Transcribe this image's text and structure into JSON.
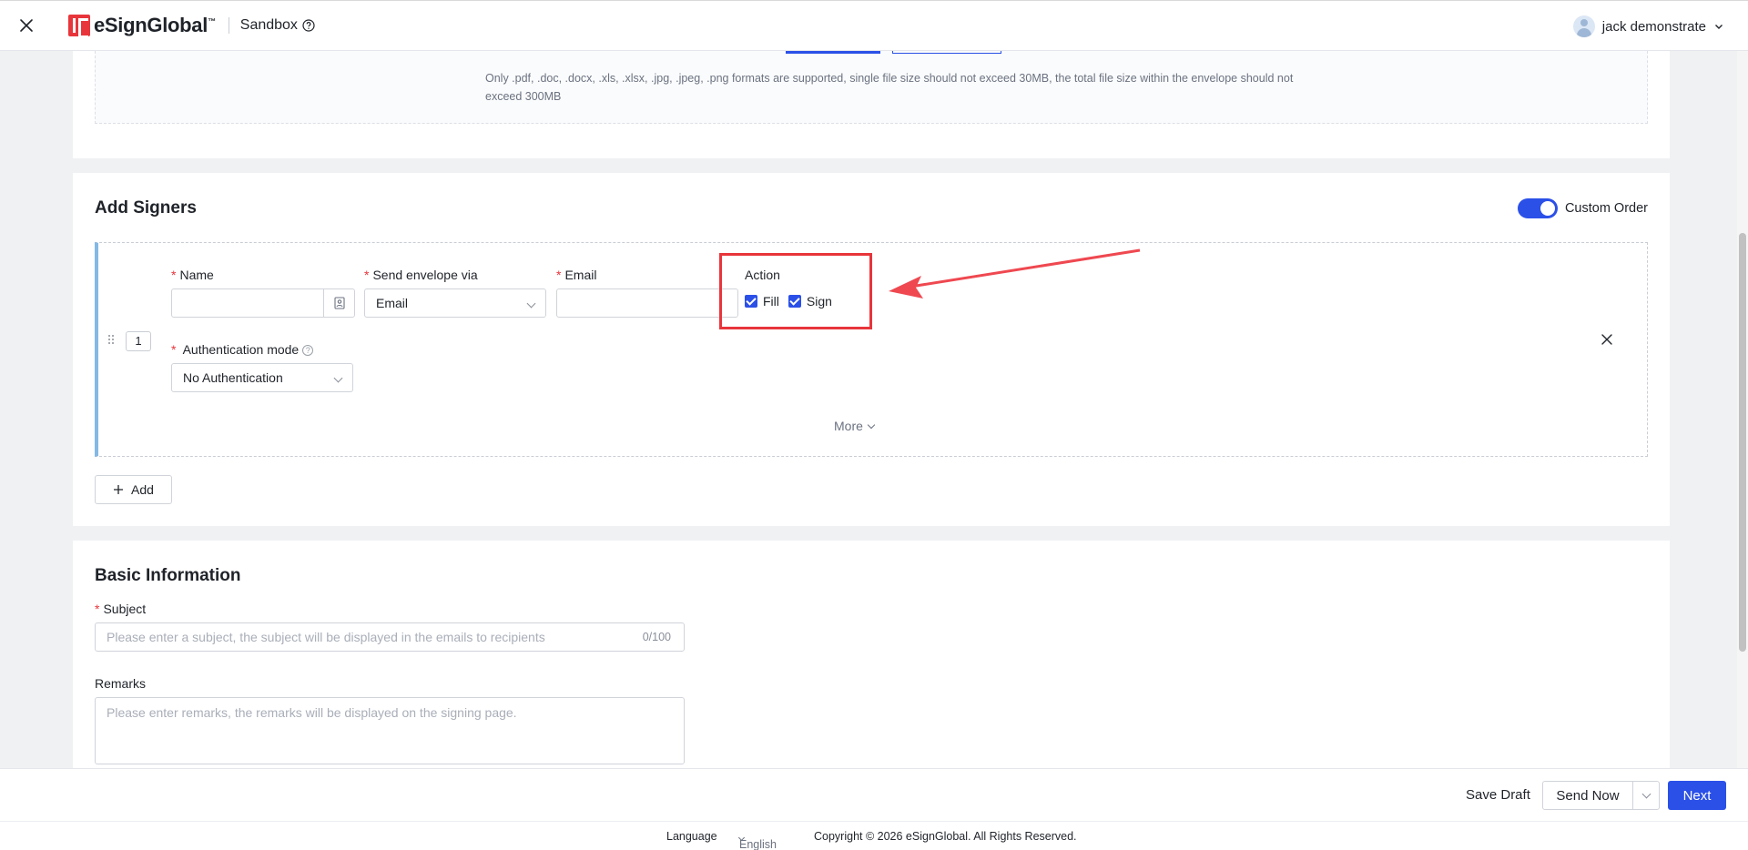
{
  "header": {
    "brand": "eSignGlobal",
    "brand_tm": "™",
    "environment": "Sandbox",
    "user_name": "jack demonstrate"
  },
  "upload": {
    "note": "Only .pdf, .doc, .docx, .xls, .xlsx, .jpg, .jpeg, .png formats are supported, single file size should not exceed 30MB, the total file size within the envelope should not exceed 300MB"
  },
  "signers": {
    "title": "Add Signers",
    "custom_order_label": "Custom Order",
    "custom_order_enabled": true,
    "rows": [
      {
        "order": "1",
        "name_label": "Name",
        "name_value": "",
        "send_via_label": "Send envelope via",
        "send_via_value": "Email",
        "email_label": "Email",
        "email_value": "",
        "action_label": "Action",
        "actions": [
          {
            "label": "Fill",
            "checked": true
          },
          {
            "label": "Sign",
            "checked": true
          }
        ],
        "auth_label": "Authentication mode",
        "auth_value": "No Authentication",
        "more_label": "More"
      }
    ],
    "add_label": "Add"
  },
  "basic": {
    "title": "Basic Information",
    "subject_label": "Subject",
    "subject_placeholder": "Please enter a subject, the subject will be displayed in the emails to recipients",
    "subject_counter": "0/100",
    "remarks_label": "Remarks",
    "remarks_placeholder": "Please enter remarks, the remarks will be displayed on the signing page."
  },
  "actions": {
    "save_draft": "Save Draft",
    "send_now": "Send Now",
    "next": "Next"
  },
  "footer": {
    "language_label": "Language",
    "language_value": "English",
    "copyright": "Copyright © 2026 eSignGlobal. All Rights Reserved."
  },
  "colors": {
    "primary": "#2b50e8",
    "required": "#e8353b",
    "highlight": "#e8353b",
    "accent_bar": "#84b9e5"
  }
}
